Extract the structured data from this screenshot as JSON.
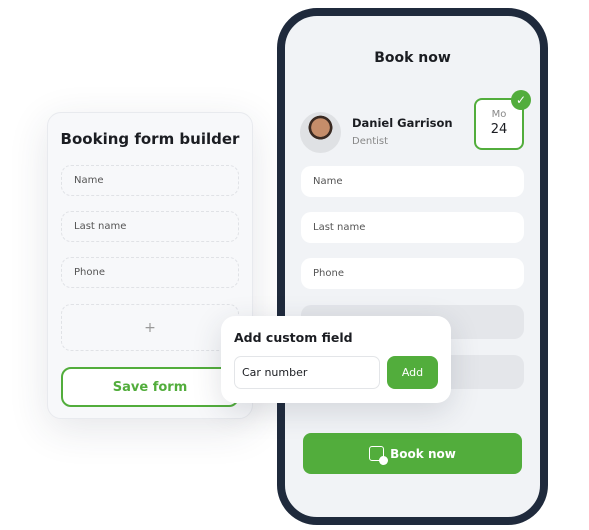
{
  "builder": {
    "title": "Booking form builder",
    "fields": [
      "Name",
      "Last name",
      "Phone"
    ],
    "add_symbol": "+",
    "save_label": "Save form"
  },
  "phone": {
    "title": "Book now",
    "specialist": {
      "name": "Daniel Garrison",
      "role": "Dentist"
    },
    "date": {
      "day": "Mo",
      "number": "24",
      "selected": true
    },
    "fields": [
      "Name",
      "Last name",
      "Phone"
    ],
    "book_label": "Book now"
  },
  "popup": {
    "title": "Add custom field",
    "input_value": "Car number",
    "add_label": "Add"
  },
  "colors": {
    "accent": "#52ad3c",
    "frame": "#1f2a3c"
  }
}
